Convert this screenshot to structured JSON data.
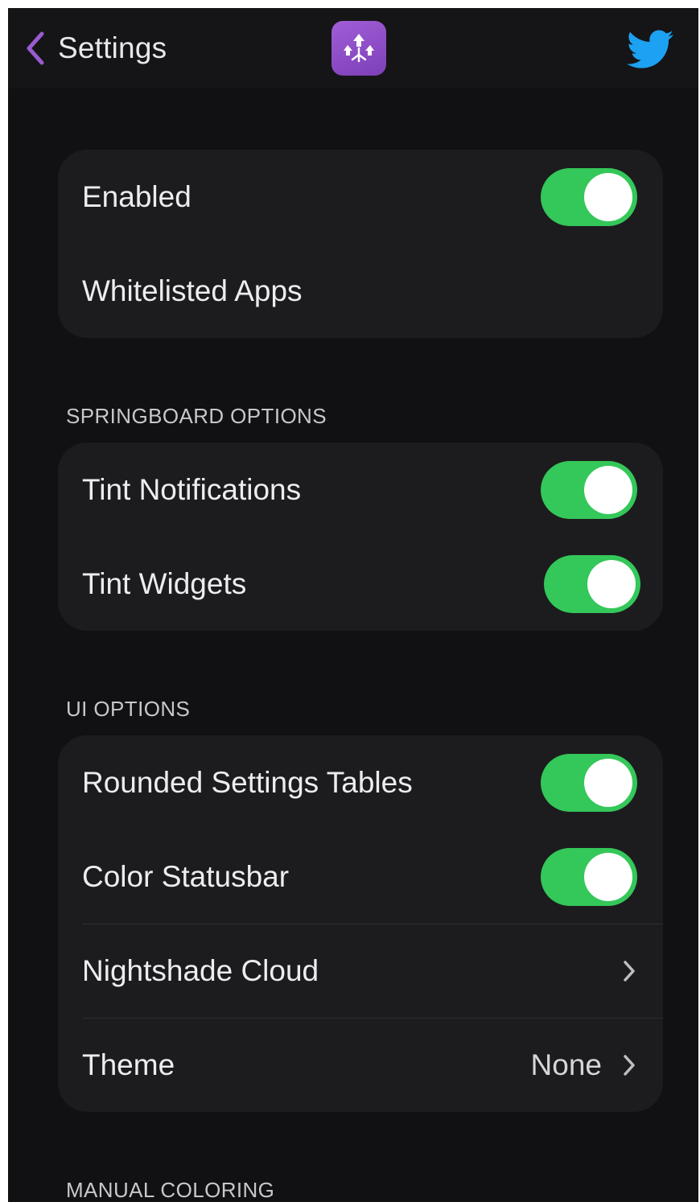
{
  "navbar": {
    "back_label": "Settings",
    "back_icon": "chevron-left-icon",
    "logo_icon": "nightshade-app-logo",
    "twitter_icon": "twitter-bird-icon"
  },
  "colors": {
    "accent": "#9a5bd0",
    "toggle_on": "#34c759",
    "twitter": "#1da1f2",
    "background": "#111113",
    "group_background": "#1c1c1e"
  },
  "general": {
    "enabled_label": "Enabled",
    "enabled_on": true,
    "whitelisted_label": "Whitelisted Apps"
  },
  "springboard": {
    "header": "SPRINGBOARD OPTIONS",
    "tint_notifications_label": "Tint Notifications",
    "tint_notifications_on": true,
    "tint_widgets_label": "Tint Widgets",
    "tint_widgets_on": true
  },
  "ui_options": {
    "header": "UI OPTIONS",
    "rounded_tables_label": "Rounded Settings Tables",
    "rounded_tables_on": true,
    "color_statusbar_label": "Color Statusbar",
    "color_statusbar_on": true,
    "cloud_label": "Nightshade Cloud",
    "theme_label": "Theme",
    "theme_value": "None"
  },
  "manual": {
    "header": "MANUAL COLORING"
  }
}
